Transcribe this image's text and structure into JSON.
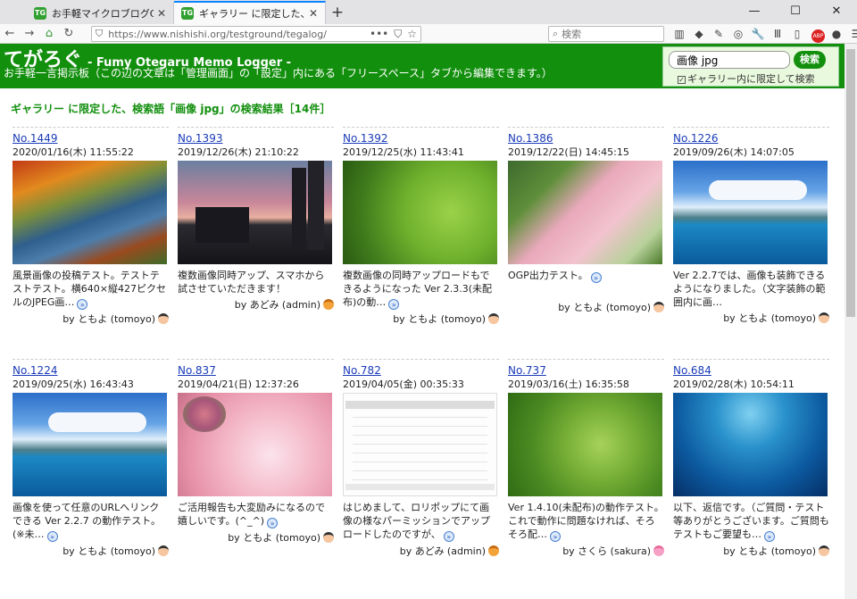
{
  "browser": {
    "tabs": [
      {
        "title": "お手軽マイクロブログCGI「てがろぐ」",
        "favicon": "TG"
      },
      {
        "title": "ギャラリー に限定した、検索語「画像",
        "favicon": "TG"
      }
    ],
    "url": "https://www.nishishi.org/testground/tegalog/",
    "search_placeholder": "検索"
  },
  "site": {
    "title": "てがろぐ",
    "subtitle": "- Fumy Otegaru Memo Logger -",
    "description": "お手軽一言掲示板（この辺の文章は「管理画面」の「設定」内にある「フリースペース」タブから編集できます。）",
    "search_value": "画像 jpg",
    "search_button": "検索",
    "filter_label": "ギャラリー内に限定して検索"
  },
  "result_heading": "ギャラリー に限定した、検索語「画像 jpg」の検索結果［14件］",
  "posts": [
    {
      "no": "No.1449",
      "date": "2020/01/16(木) 11:55:22",
      "text": "風景画像の投稿テスト。テストテストテスト。横640×縦427ピクセルのJPEG画…",
      "by": "by ともよ (tomoyo)",
      "thumb": "river",
      "avatar": "tomoyo"
    },
    {
      "no": "No.1393",
      "date": "2019/12/26(木) 21:10:22",
      "text": "複数画像同時アップ、スマホから試させていただきます！",
      "by": "by あどみ (admin)",
      "thumb": "city",
      "avatar": "admin"
    },
    {
      "no": "No.1392",
      "date": "2019/12/25(水) 11:43:41",
      "text": "複数画像の同時アップロードもできるようになった Ver 2.3.3(未配布)の動…",
      "by": "by ともよ (tomoyo)",
      "thumb": "forest",
      "avatar": "tomoyo"
    },
    {
      "no": "No.1386",
      "date": "2019/12/22(日) 14:45:15",
      "text": "OGP出力テスト。",
      "by": "by ともよ (tomoyo)",
      "thumb": "mochi",
      "avatar": "tomoyo"
    },
    {
      "no": "No.1226",
      "date": "2019/09/26(木) 14:07:05",
      "text": "Ver 2.2.7では、画像も装飾できるようになりました。（文字装飾の範囲内に画…",
      "by": "by ともよ (tomoyo)",
      "thumb": "sea",
      "avatar": "tomoyo"
    },
    {
      "no": "No.1224",
      "date": "2019/09/25(水) 16:43:43",
      "text": "画像を使って任意のURLへリンクできる Ver 2.2.7 の動作テスト。(※未…",
      "by": "by ともよ (tomoyo)",
      "thumb": "sea",
      "avatar": "tomoyo"
    },
    {
      "no": "No.837",
      "date": "2019/04/21(日) 12:37:26",
      "text": "ご活用報告も大変励みになるので嬉しいです。(^_^)",
      "by": "by ともよ (tomoyo)",
      "thumb": "pink",
      "avatar": "tomoyo"
    },
    {
      "no": "No.782",
      "date": "2019/04/05(金) 00:35:33",
      "text": "はじめまして、ロリポップにて画像の様なパーミッションでアップロードしたのですが、",
      "by": "by あどみ (admin)",
      "thumb": "files",
      "avatar": "admin"
    },
    {
      "no": "No.737",
      "date": "2019/03/16(土) 16:35:58",
      "text": "Ver 1.4.10(未配布)の動作テスト。これで動作に問題なければ、そろそろ配…",
      "by": "by さくら (sakura)",
      "thumb": "forest2",
      "avatar": "sakura"
    },
    {
      "no": "No.684",
      "date": "2019/02/28(木) 10:54:11",
      "text": "以下、返信です。（ご質問・テスト等ありがとうございます。ご質問もテストもご要望も…",
      "by": "by ともよ (tomoyo)",
      "thumb": "under",
      "avatar": "tomoyo"
    }
  ]
}
